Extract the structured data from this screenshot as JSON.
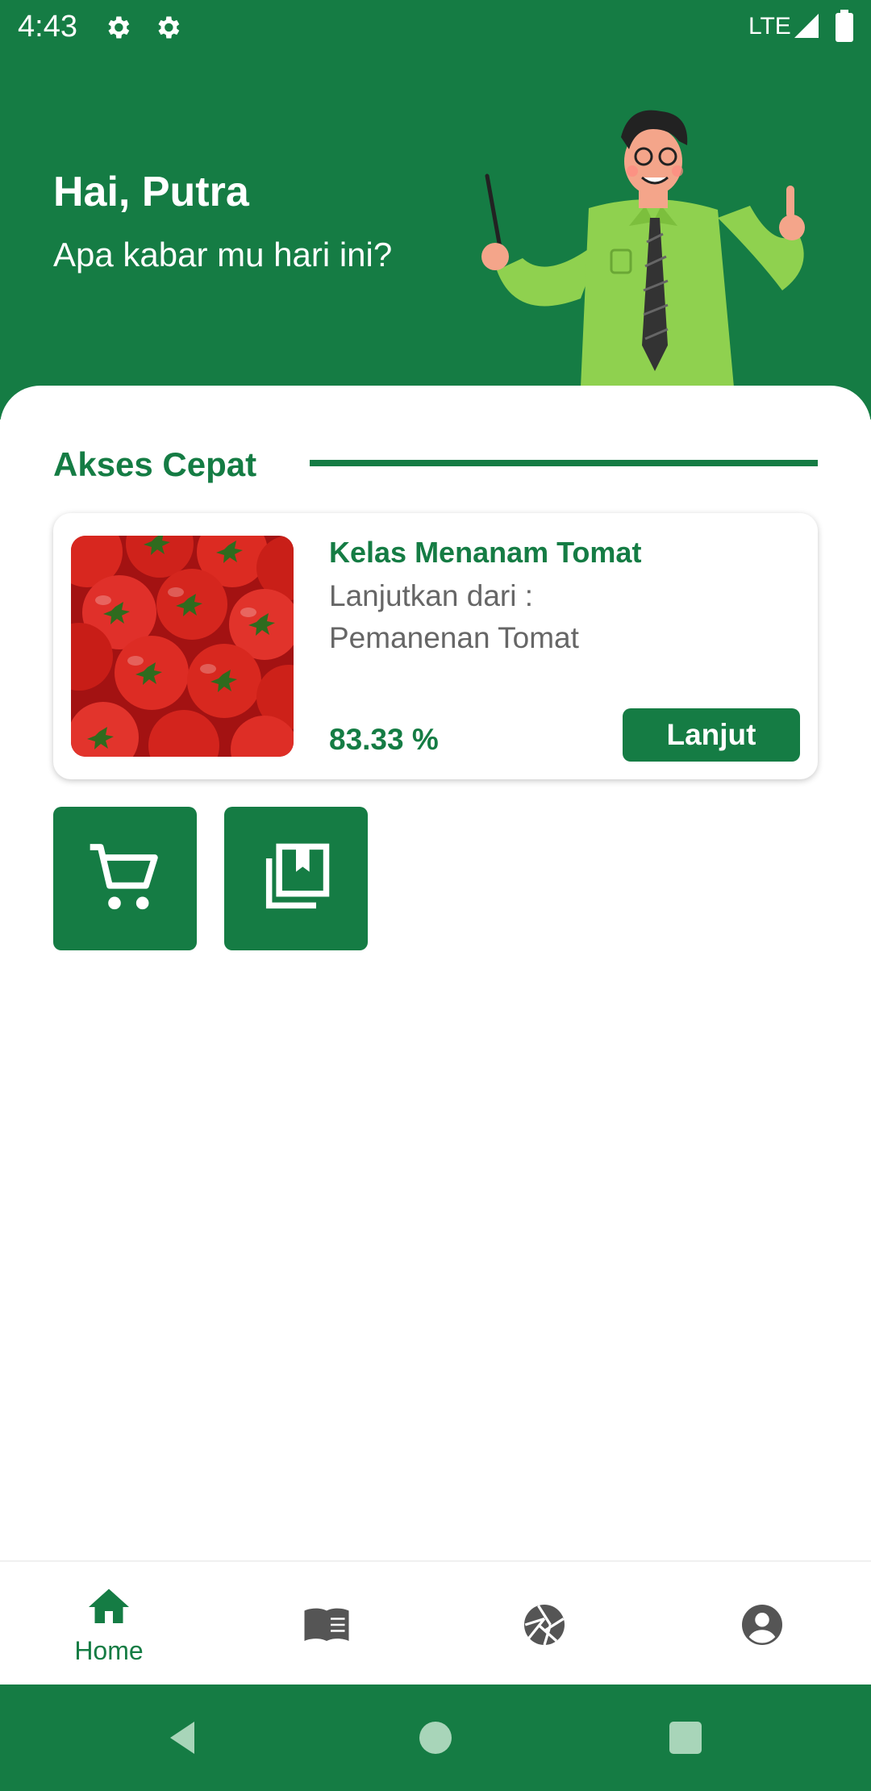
{
  "status_bar": {
    "time": "4:43",
    "network": "LTE"
  },
  "header": {
    "greeting": "Hai, Putra",
    "subtitle": "Apa kabar mu hari ini?"
  },
  "quick_access": {
    "title": "Akses Cepat",
    "card": {
      "title": "Kelas Menanam Tomat",
      "continue_label": "Lanjutkan dari :",
      "lesson": "Pemanenan Tomat",
      "progress": "83.33 %",
      "button": "Lanjut"
    },
    "buttons": [
      {
        "icon": "cart-icon"
      },
      {
        "icon": "library-bookmark-icon"
      }
    ]
  },
  "bottom_nav": {
    "items": [
      {
        "icon": "home-icon",
        "label": "Home",
        "active": true
      },
      {
        "icon": "book-icon",
        "label": ""
      },
      {
        "icon": "aperture-icon",
        "label": ""
      },
      {
        "icon": "account-circle-icon",
        "label": ""
      }
    ]
  },
  "colors": {
    "primary": "#157c44",
    "text_secondary": "#666666",
    "background": "#ffffff",
    "nav_inactive": "#555555"
  }
}
